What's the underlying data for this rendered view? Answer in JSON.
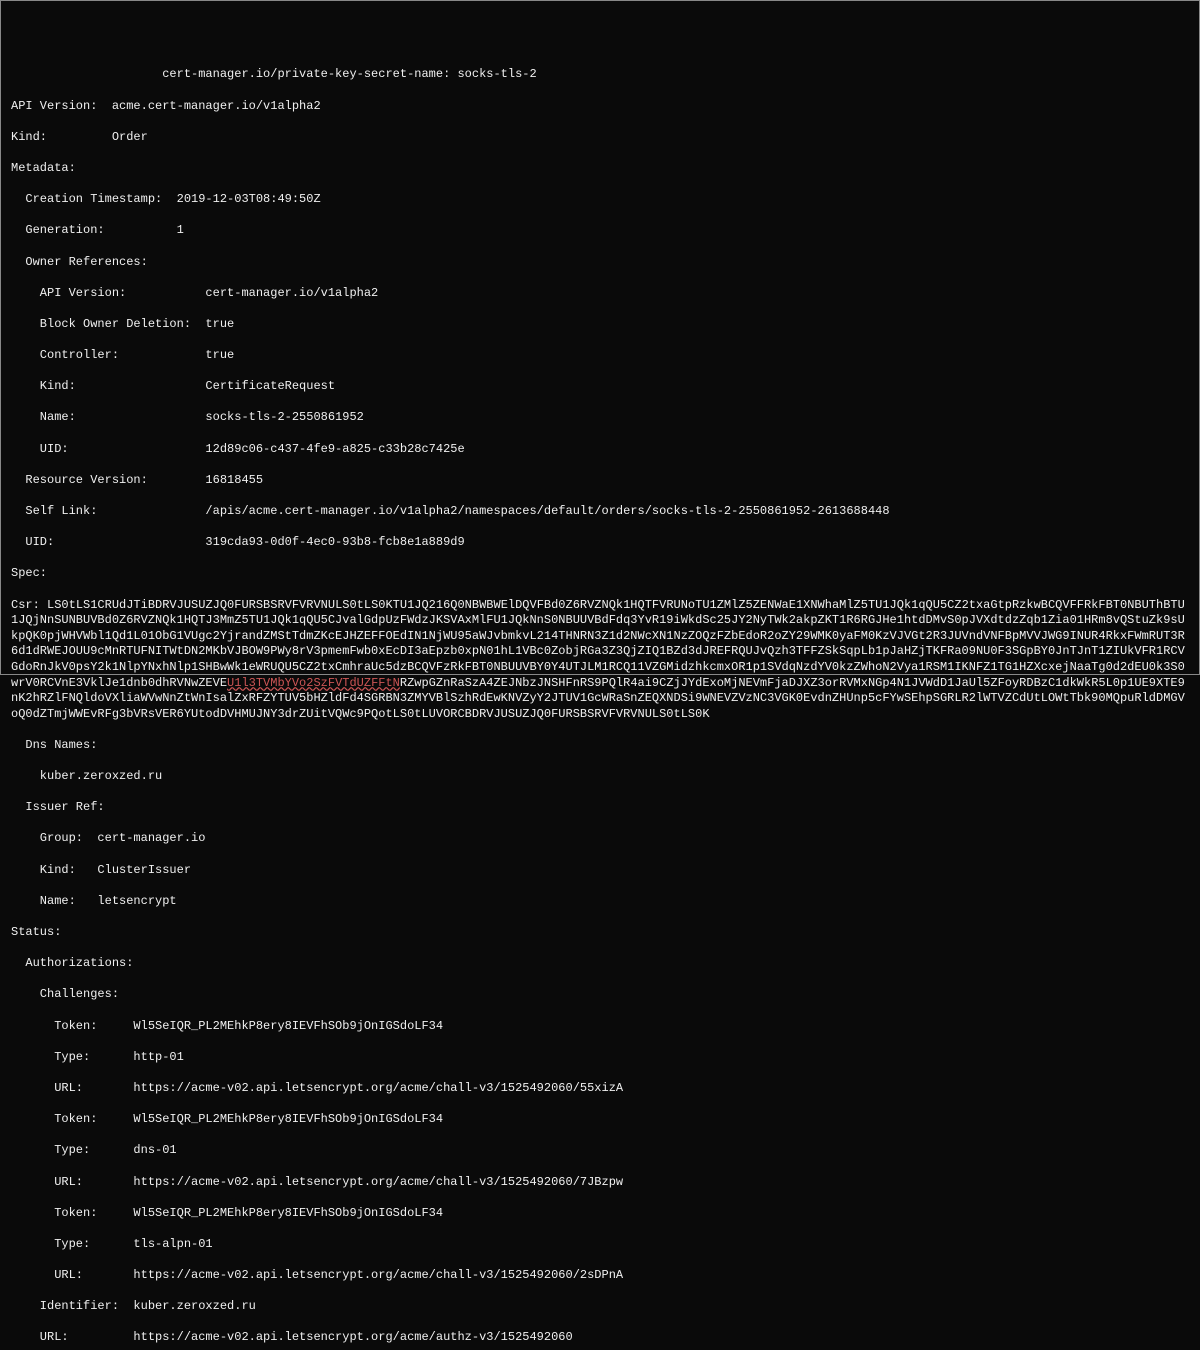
{
  "lines": {
    "l1": "                     cert-manager.io/private-key-secret-name: socks-tls-2",
    "l2": "API Version:  acme.cert-manager.io/v1alpha2",
    "l3": "Kind:         Order",
    "l4": "Metadata:",
    "l5": "  Creation Timestamp:  2019-12-03T08:49:50Z",
    "l6": "  Generation:          1",
    "l7": "  Owner References:",
    "l8": "    API Version:           cert-manager.io/v1alpha2",
    "l9": "    Block Owner Deletion:  true",
    "l10": "    Controller:            true",
    "l11": "    Kind:                  CertificateRequest",
    "l12": "    Name:                  socks-tls-2-2550861952",
    "l13": "    UID:                   12d89c06-c437-4fe9-a825-c33b28c7425e",
    "l14": "  Resource Version:        16818455",
    "l15": "  Self Link:               /apis/acme.cert-manager.io/v1alpha2/namespaces/default/orders/socks-tls-2-2550861952-2613688448",
    "l16": "  UID:                     319cda93-0d0f-4ec0-93b8-fcb8e1a889d9",
    "l17": "Spec:",
    "csr_prefix": "  Csr:   ",
    "csr_part1": "LS0tLS1CRUdJTiBDRVJUSUZJQ0FURSBSRVFVRVNULS0tLS0KTU1JQ216Q0NBWBWElDQVFBd0Z6RVZNQk1HQTFVRUNoTU1ZMlZ5ZENWaE1XNWhaMlZ5TU1JQk1qQU5CZ2txaGtpRzkwBCQVFFRkFBT0NBUThBTU1JQjNnSUNBUVBd0Z6RVZNQk1HQTJ3MmZ5TU1JQk1qQU5CJvalGdpUzFWdzJKSVAxMlFU1JQkNnS0NBUUVBdFdq3YvR19iWkdSc25JY2NyTWk2akpZKT1R6RGJHe1htdDMvS0pJVXdtdzZqb1Zia01HRm8vQStuZk9sUkpQK0pjWHVWbl1Qd1L01ObG1VUgc2YjrandZMStTdmZKcEJHZEFFOEdIN1NjWU95aWJvbmkvL214THNRN3Z1d2NWcXN1NzZOQzFZbEdoR2oZY29WMK0yaFM0KzVJVGt2R3JUVndVNFBpMVVJWG9INUR4RkxFWmRUT3R6d1dRWEJOUU9cMnRTUFNITWtDN2MKbVJBOW9PWy8rV3pmemFwb0xEcDI3aEpzb0xpN01hL1VBc0ZobjRGa3Z3QjZIQ1BZd3dJREFRQUJvQzh3TFFZSkSqpLb1pJaHZjTKFRa09NU0F3SGpBY0JnTJnT1ZIUkVFR1RCVGdoRnJkV0psY2k1NlpYNxhNlp1SHBwWk1eWRUQU5CZ2txCmhraUc5dzBCQVFzRkFBT0NBUUVBY0Y4UTJLM1RCQ11VZGMidzhkcmxOR1p1SVdqNzdYV0kzZWhoN2Vya1RSM1IKNFZ1TG1HZXcxejNaaTg0d2dEU0k3S0wrV0RCVnE3VklJe1dnb0dhRVNwZEVE",
    "csr_highlight": "U1l3TVMbYVo2SzFVTdUZFFtN",
    "csr_part2": "RZwpGZnRaSzA4ZEJNbzJNSHFnRS9PQlR4ai9CZjJYdExoMjNEVmFjaDJXZ3orRVMxNGp4N1JVWdD1JaUl5ZFoyRDBzC1dkWkR5L0p1UE9XTE9nK2hRZlFNQldoVXliaWVwNnZtWnIsalZxRFZYTUV5bHZldFd4SGRBN3ZMYVBlSzhRdEwKNVZyY2JTUV1GcWRaSnZEQXNDSi9WNEVZVzNC3VGK0EvdnZHUnp5cFYwSEhpSGRLR2lWTVZCdUtLOWtTbk90MQpuRldDMGVoQ0dZTmjWWEvRFg3bVRsVER6YUtodDVHMUJNY3drZUitVQWc9PQotLS0tLUVORCBDRVJUSUZJQ0FURSBSRVFVRVNULS0tLS0K",
    "l25": "  Dns Names:",
    "l26": "    kuber.zeroxzed.ru",
    "l27": "  Issuer Ref:",
    "l28": "    Group:  cert-manager.io",
    "l29": "    Kind:   ClusterIssuer",
    "l30": "    Name:   letsencrypt",
    "l31": "Status:",
    "l32": "  Authorizations:",
    "l33": "    Challenges:",
    "l34": "      Token:     Wl5SeIQR_PL2MEhkP8ery8IEVFhSOb9jOnIGSdoLF34",
    "l35": "      Type:      http-01",
    "l36": "      URL:       https://acme-v02.api.letsencrypt.org/acme/chall-v3/1525492060/55xizA",
    "l37": "      Token:     Wl5SeIQR_PL2MEhkP8ery8IEVFhSOb9jOnIGSdoLF34",
    "l38": "      Type:      dns-01",
    "l39": "      URL:       https://acme-v02.api.letsencrypt.org/acme/chall-v3/1525492060/7JBzpw",
    "l40": "      Token:     Wl5SeIQR_PL2MEhkP8ery8IEVFhSOb9jOnIGSdoLF34",
    "l41": "      Type:      tls-alpn-01",
    "l42": "      URL:       https://acme-v02.api.letsencrypt.org/acme/chall-v3/1525492060/2sDPnA",
    "l43": "    Identifier:  kuber.zeroxzed.ru",
    "l44": "    URL:         https://acme-v02.api.letsencrypt.org/acme/authz-v3/1525492060"
  }
}
